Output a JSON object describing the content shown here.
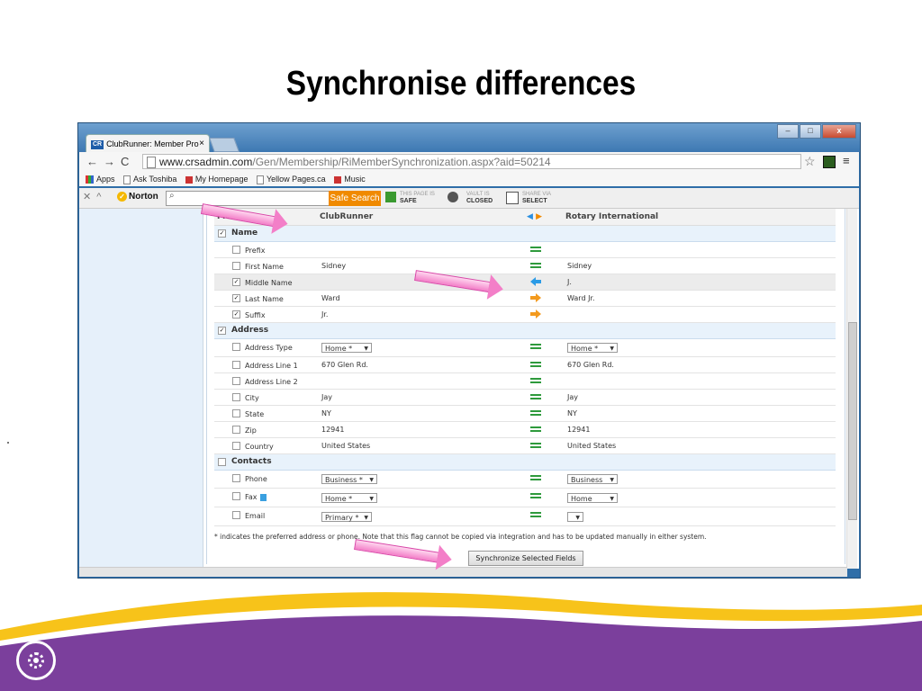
{
  "slide": {
    "title": "Synchronise differences"
  },
  "browser": {
    "tab_title": "ClubRunner: Member Pro",
    "tab_favicon": "CR",
    "tab_close": "×",
    "url_host": "www.crsadmin.com",
    "url_path": "/Gen/Membership/RiMemberSynchronization.aspx?aid=50214",
    "bookmarks": [
      "Apps",
      "Ask Toshiba",
      "My Homepage",
      "Yellow Pages.ca",
      "Music"
    ]
  },
  "norton": {
    "brand": "Norton",
    "safe_search_label": "Safe Search",
    "status1_top": "THIS PAGE IS",
    "status1_bottom": "SAFE",
    "status2_top": "VAULT IS",
    "status2_bottom": "CLOSED",
    "status3_top": "SHARE VIA",
    "status3_bottom": "SELECT"
  },
  "grid": {
    "headers": {
      "field": "Field",
      "clubrunner": "ClubRunner",
      "rotary": "Rotary International"
    },
    "sections": {
      "name": "Name",
      "address": "Address",
      "contacts": "Contacts"
    },
    "name_rows": [
      {
        "label": "Prefix",
        "checked": false,
        "cr": "",
        "ri": "",
        "sync": "equal"
      },
      {
        "label": "First Name",
        "checked": false,
        "cr": "Sidney",
        "ri": "Sidney",
        "sync": "equal"
      },
      {
        "label": "Middle Name",
        "checked": true,
        "cr": "",
        "ri": "J.",
        "sync": "to-clubrunner"
      },
      {
        "label": "Last Name",
        "checked": true,
        "cr": "Ward",
        "ri": "Ward Jr.",
        "sync": "to-rotary"
      },
      {
        "label": "Suffix",
        "checked": true,
        "cr": "Jr.",
        "ri": "",
        "sync": "to-rotary"
      }
    ],
    "address_rows": {
      "address_type": {
        "label": "Address Type",
        "cr_select": "Home *",
        "ri_select": "Home *"
      },
      "line1": {
        "label": "Address Line 1",
        "cr": "670 Glen Rd.",
        "ri": "670 Glen Rd."
      },
      "line2": {
        "label": "Address Line 2",
        "cr": "",
        "ri": ""
      },
      "city": {
        "label": "City",
        "cr": "Jay",
        "ri": "Jay"
      },
      "state": {
        "label": "State",
        "cr": "NY",
        "ri": "NY"
      },
      "zip": {
        "label": "Zip",
        "cr": "12941",
        "ri": "12941"
      },
      "country": {
        "label": "Country",
        "cr": "United States",
        "ri": "United States"
      }
    },
    "contact_rows": {
      "phone": {
        "label": "Phone",
        "cr_select": "Business *",
        "ri_select": "Business"
      },
      "fax": {
        "label": "Fax",
        "cr_select": "Home *",
        "ri_select": "Home"
      },
      "email": {
        "label": "Email",
        "cr_select": "Primary *",
        "ri_select": ""
      }
    },
    "note": "* indicates the preferred address or phone. Note that this flag cannot be copied via integration and has to be updated manually in either system.",
    "sync_button": "Synchronize Selected Fields"
  },
  "colors": {
    "purple": "#7b3f9c",
    "gold": "#f7c31a",
    "equal_green": "#2e9a3c",
    "arrow_blue": "#2b9be6",
    "arrow_orange": "#f39a1e",
    "callout_pink": "#f37fc8"
  }
}
